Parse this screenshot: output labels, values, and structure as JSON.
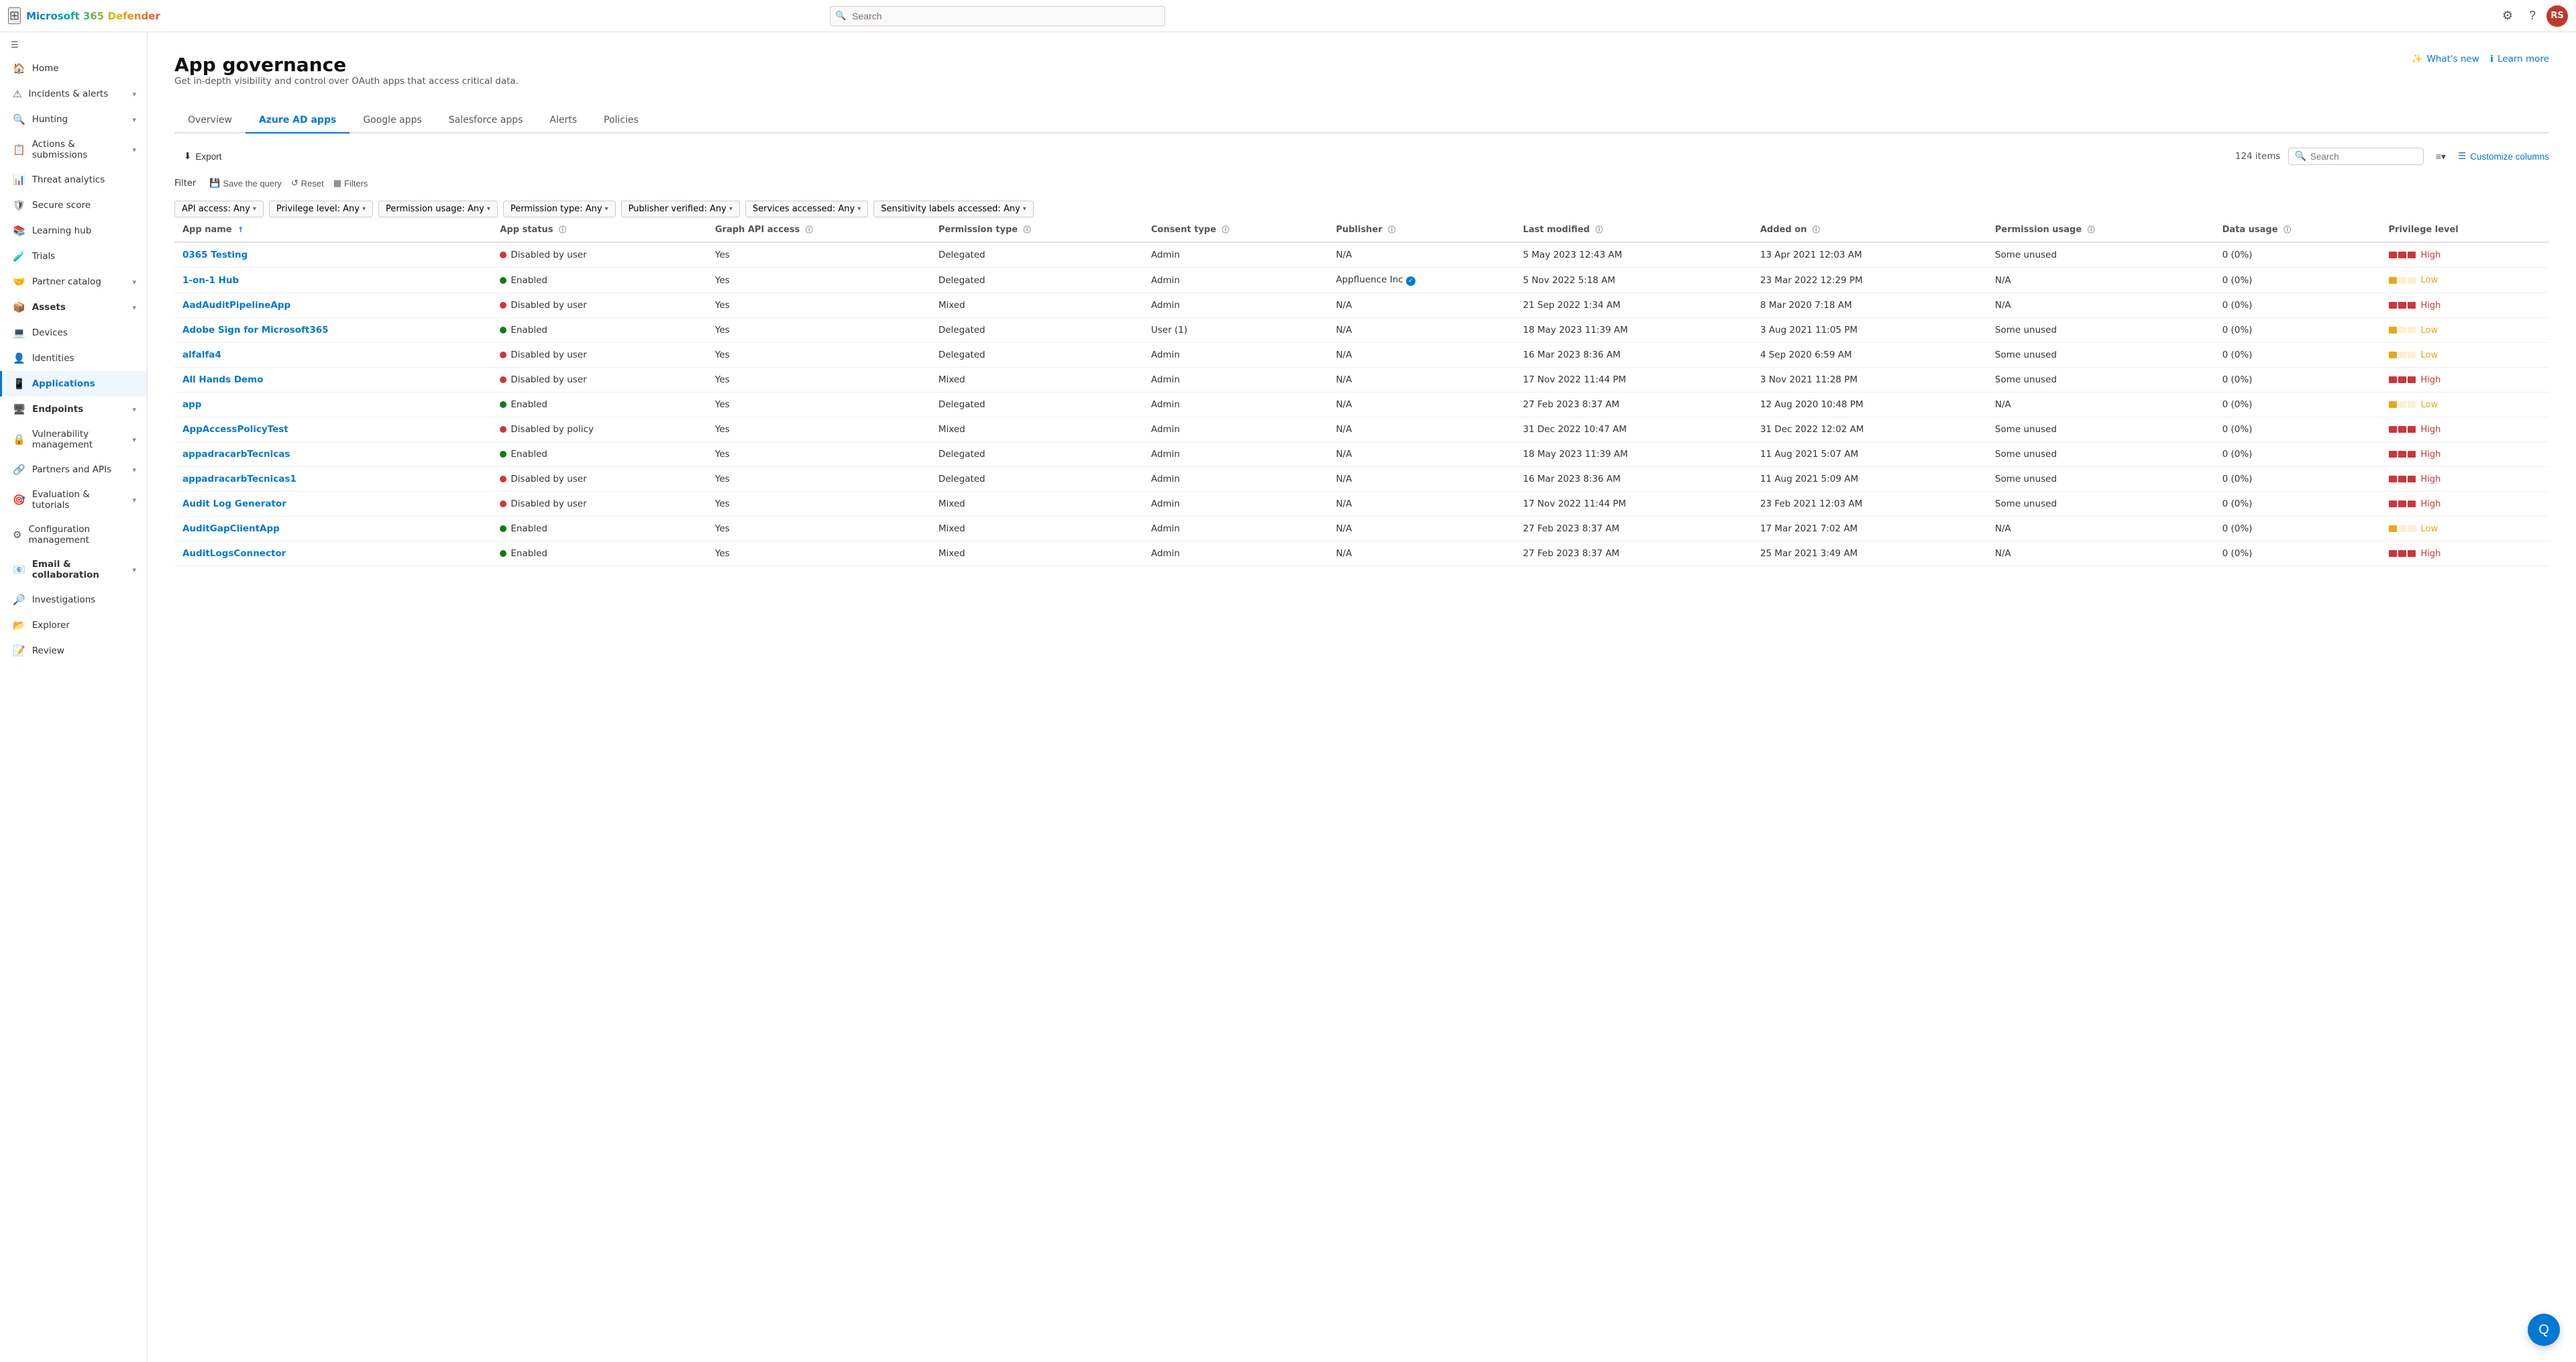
{
  "topbar": {
    "waffle_label": "⊞",
    "brand": "Microsoft 365 Defender",
    "search_placeholder": "Search",
    "settings_icon": "⚙",
    "help_icon": "?",
    "avatar_initials": "RS"
  },
  "sidebar": {
    "collapse_icon": "☰",
    "items": [
      {
        "id": "home",
        "icon": "🏠",
        "label": "Home",
        "active": false,
        "has_chevron": false
      },
      {
        "id": "incidents",
        "icon": "⚠",
        "label": "Incidents & alerts",
        "active": false,
        "has_chevron": true
      },
      {
        "id": "hunting",
        "icon": "🔍",
        "label": "Hunting",
        "active": false,
        "has_chevron": true
      },
      {
        "id": "actions",
        "icon": "📋",
        "label": "Actions & submissions",
        "active": false,
        "has_chevron": true
      },
      {
        "id": "threat",
        "icon": "📊",
        "label": "Threat analytics",
        "active": false,
        "has_chevron": false
      },
      {
        "id": "secure",
        "icon": "🛡",
        "label": "Secure score",
        "active": false,
        "has_chevron": false
      },
      {
        "id": "learning",
        "icon": "📚",
        "label": "Learning hub",
        "active": false,
        "has_chevron": false
      },
      {
        "id": "trials",
        "icon": "🧪",
        "label": "Trials",
        "active": false,
        "has_chevron": false
      },
      {
        "id": "partner",
        "icon": "🤝",
        "label": "Partner catalog",
        "active": false,
        "has_chevron": true
      },
      {
        "id": "assets_header",
        "icon": "",
        "label": "Assets",
        "is_section": true,
        "has_chevron": true
      },
      {
        "id": "devices",
        "icon": "💻",
        "label": "Devices",
        "active": false,
        "has_chevron": false
      },
      {
        "id": "identities",
        "icon": "👤",
        "label": "Identities",
        "active": false,
        "has_chevron": false
      },
      {
        "id": "applications",
        "icon": "📱",
        "label": "Applications",
        "active": true,
        "has_chevron": false
      },
      {
        "id": "endpoints_header",
        "icon": "",
        "label": "Endpoints",
        "is_section": true,
        "has_chevron": true
      },
      {
        "id": "vulnerability",
        "icon": "🔒",
        "label": "Vulnerability management",
        "active": false,
        "has_chevron": true
      },
      {
        "id": "partners",
        "icon": "🔗",
        "label": "Partners and APIs",
        "active": false,
        "has_chevron": true
      },
      {
        "id": "evaluation",
        "icon": "🎯",
        "label": "Evaluation & tutorials",
        "active": false,
        "has_chevron": true
      },
      {
        "id": "config",
        "icon": "⚙",
        "label": "Configuration management",
        "active": false,
        "has_chevron": false
      },
      {
        "id": "email_collab",
        "icon": "📧",
        "label": "Email & collaboration",
        "active": false,
        "has_chevron": true
      },
      {
        "id": "investigations",
        "icon": "🔎",
        "label": "Investigations",
        "active": false,
        "has_chevron": false
      },
      {
        "id": "explorer",
        "icon": "📂",
        "label": "Explorer",
        "active": false,
        "has_chevron": false
      },
      {
        "id": "review",
        "icon": "📝",
        "label": "Review",
        "active": false,
        "has_chevron": false
      }
    ]
  },
  "page": {
    "title": "App governance",
    "subtitle": "Get in-depth visibility and control over OAuth apps that access critical data.",
    "whats_new_label": "What's new",
    "learn_more_label": "Learn more"
  },
  "tabs": [
    {
      "id": "overview",
      "label": "Overview",
      "active": false
    },
    {
      "id": "azure_ad_apps",
      "label": "Azure AD apps",
      "active": true
    },
    {
      "id": "google_apps",
      "label": "Google apps",
      "active": false
    },
    {
      "id": "salesforce_apps",
      "label": "Salesforce apps",
      "active": false
    },
    {
      "id": "alerts",
      "label": "Alerts",
      "active": false
    },
    {
      "id": "policies",
      "label": "Policies",
      "active": false
    }
  ],
  "toolbar": {
    "export_icon": "⬇",
    "export_label": "Export",
    "item_count": "124 items",
    "search_placeholder": "Search",
    "group_icon": "≡",
    "customize_icon": "☰",
    "customize_label": "Customize columns"
  },
  "filters": {
    "label": "Filter",
    "save_query_label": "Save the query",
    "reset_label": "Reset",
    "filters_label": "Filters",
    "chips": [
      {
        "label": "API access:",
        "value": "Any"
      },
      {
        "label": "Privilege level:",
        "value": "Any"
      },
      {
        "label": "Permission usage:",
        "value": "Any"
      },
      {
        "label": "Permission type:",
        "value": "Any"
      },
      {
        "label": "Publisher verified:",
        "value": "Any"
      },
      {
        "label": "Services accessed:",
        "value": "Any"
      },
      {
        "label": "Sensitivity labels accessed:",
        "value": "Any"
      }
    ]
  },
  "table": {
    "columns": [
      {
        "key": "app_name",
        "label": "App name",
        "sortable": true,
        "sort_dir": "asc"
      },
      {
        "key": "app_status",
        "label": "App status",
        "has_info": true
      },
      {
        "key": "graph_api",
        "label": "Graph API access",
        "has_info": true
      },
      {
        "key": "permission_type",
        "label": "Permission type",
        "has_info": true
      },
      {
        "key": "consent_type",
        "label": "Consent type",
        "has_info": true
      },
      {
        "key": "publisher",
        "label": "Publisher",
        "has_info": true
      },
      {
        "key": "last_modified",
        "label": "Last modified",
        "has_info": true
      },
      {
        "key": "added_on",
        "label": "Added on",
        "has_info": true
      },
      {
        "key": "permission_usage",
        "label": "Permission usage",
        "has_info": true
      },
      {
        "key": "data_usage",
        "label": "Data usage",
        "has_info": true
      },
      {
        "key": "privilege_level",
        "label": "Privilege level"
      }
    ],
    "rows": [
      {
        "app_name": "0365 Testing",
        "app_status": "Disabled by user",
        "app_status_type": "disabled",
        "graph_api": "Yes",
        "permission_type": "Delegated",
        "consent_type": "Admin",
        "publisher": "N/A",
        "publisher_verified": false,
        "last_modified": "5 May 2023 12:43 AM",
        "added_on": "13 Apr 2021 12:03 AM",
        "permission_usage": "Some unused",
        "data_usage": "0 (0%)",
        "privilege_level": "High",
        "privilege_type": "high"
      },
      {
        "app_name": "1-on-1 Hub",
        "app_status": "Enabled",
        "app_status_type": "enabled",
        "graph_api": "Yes",
        "permission_type": "Delegated",
        "consent_type": "Admin",
        "publisher": "Appfluence Inc",
        "publisher_verified": true,
        "last_modified": "5 Nov 2022 5:18 AM",
        "added_on": "23 Mar 2022 12:29 PM",
        "permission_usage": "N/A",
        "data_usage": "0 (0%)",
        "privilege_level": "Low",
        "privilege_type": "low"
      },
      {
        "app_name": "AadAuditPipelineApp",
        "app_status": "Disabled by user",
        "app_status_type": "disabled",
        "graph_api": "Yes",
        "permission_type": "Mixed",
        "consent_type": "Admin",
        "publisher": "N/A",
        "publisher_verified": false,
        "last_modified": "21 Sep 2022 1:34 AM",
        "added_on": "8 Mar 2020 7:18 AM",
        "permission_usage": "N/A",
        "data_usage": "0 (0%)",
        "privilege_level": "High",
        "privilege_type": "high"
      },
      {
        "app_name": "Adobe Sign for Microsoft365",
        "app_status": "Enabled",
        "app_status_type": "enabled",
        "graph_api": "Yes",
        "permission_type": "Delegated",
        "consent_type": "User (1)",
        "publisher": "N/A",
        "publisher_verified": false,
        "last_modified": "18 May 2023 11:39 AM",
        "added_on": "3 Aug 2021 11:05 PM",
        "permission_usage": "Some unused",
        "data_usage": "0 (0%)",
        "privilege_level": "Low",
        "privilege_type": "low"
      },
      {
        "app_name": "alfalfa4",
        "app_status": "Disabled by user",
        "app_status_type": "disabled",
        "graph_api": "Yes",
        "permission_type": "Delegated",
        "consent_type": "Admin",
        "publisher": "N/A",
        "publisher_verified": false,
        "last_modified": "16 Mar 2023 8:36 AM",
        "added_on": "4 Sep 2020 6:59 AM",
        "permission_usage": "Some unused",
        "data_usage": "0 (0%)",
        "privilege_level": "Low",
        "privilege_type": "low"
      },
      {
        "app_name": "All Hands Demo",
        "app_status": "Disabled by user",
        "app_status_type": "disabled",
        "graph_api": "Yes",
        "permission_type": "Mixed",
        "consent_type": "Admin",
        "publisher": "N/A",
        "publisher_verified": false,
        "last_modified": "17 Nov 2022 11:44 PM",
        "added_on": "3 Nov 2021 11:28 PM",
        "permission_usage": "Some unused",
        "data_usage": "0 (0%)",
        "privilege_level": "High",
        "privilege_type": "high"
      },
      {
        "app_name": "app",
        "app_status": "Enabled",
        "app_status_type": "enabled",
        "graph_api": "Yes",
        "permission_type": "Delegated",
        "consent_type": "Admin",
        "publisher": "N/A",
        "publisher_verified": false,
        "last_modified": "27 Feb 2023 8:37 AM",
        "added_on": "12 Aug 2020 10:48 PM",
        "permission_usage": "N/A",
        "data_usage": "0 (0%)",
        "privilege_level": "Low",
        "privilege_type": "low"
      },
      {
        "app_name": "AppAccessPolicyTest",
        "app_status": "Disabled by policy",
        "app_status_type": "disabled",
        "graph_api": "Yes",
        "permission_type": "Mixed",
        "consent_type": "Admin",
        "publisher": "N/A",
        "publisher_verified": false,
        "last_modified": "31 Dec 2022 10:47 AM",
        "added_on": "31 Dec 2022 12:02 AM",
        "permission_usage": "Some unused",
        "data_usage": "0 (0%)",
        "privilege_level": "High",
        "privilege_type": "high"
      },
      {
        "app_name": "appadracarbTecnicas",
        "app_status": "Enabled",
        "app_status_type": "enabled",
        "graph_api": "Yes",
        "permission_type": "Delegated",
        "consent_type": "Admin",
        "publisher": "N/A",
        "publisher_verified": false,
        "last_modified": "18 May 2023 11:39 AM",
        "added_on": "11 Aug 2021 5:07 AM",
        "permission_usage": "Some unused",
        "data_usage": "0 (0%)",
        "privilege_level": "High",
        "privilege_type": "high"
      },
      {
        "app_name": "appadracarbTecnicas1",
        "app_status": "Disabled by user",
        "app_status_type": "disabled",
        "graph_api": "Yes",
        "permission_type": "Delegated",
        "consent_type": "Admin",
        "publisher": "N/A",
        "publisher_verified": false,
        "last_modified": "16 Mar 2023 8:36 AM",
        "added_on": "11 Aug 2021 5:09 AM",
        "permission_usage": "Some unused",
        "data_usage": "0 (0%)",
        "privilege_level": "High",
        "privilege_type": "high"
      },
      {
        "app_name": "Audit Log Generator",
        "app_status": "Disabled by user",
        "app_status_type": "disabled",
        "graph_api": "Yes",
        "permission_type": "Mixed",
        "consent_type": "Admin",
        "publisher": "N/A",
        "publisher_verified": false,
        "last_modified": "17 Nov 2022 11:44 PM",
        "added_on": "23 Feb 2021 12:03 AM",
        "permission_usage": "Some unused",
        "data_usage": "0 (0%)",
        "privilege_level": "High",
        "privilege_type": "high"
      },
      {
        "app_name": "AuditGapClientApp",
        "app_status": "Enabled",
        "app_status_type": "enabled",
        "graph_api": "Yes",
        "permission_type": "Mixed",
        "consent_type": "Admin",
        "publisher": "N/A",
        "publisher_verified": false,
        "last_modified": "27 Feb 2023 8:37 AM",
        "added_on": "17 Mar 2021 7:02 AM",
        "permission_usage": "N/A",
        "data_usage": "0 (0%)",
        "privilege_level": "Low",
        "privilege_type": "low"
      },
      {
        "app_name": "AuditLogsConnector",
        "app_status": "Enabled",
        "app_status_type": "enabled",
        "graph_api": "Yes",
        "permission_type": "Mixed",
        "consent_type": "Admin",
        "publisher": "N/A",
        "publisher_verified": false,
        "last_modified": "27 Feb 2023 8:37 AM",
        "added_on": "25 Mar 2021 3:49 AM",
        "permission_usage": "N/A",
        "data_usage": "0 (0%)",
        "privilege_level": "High",
        "privilege_type": "high"
      }
    ]
  },
  "floating_btn": {
    "label": "Q"
  }
}
